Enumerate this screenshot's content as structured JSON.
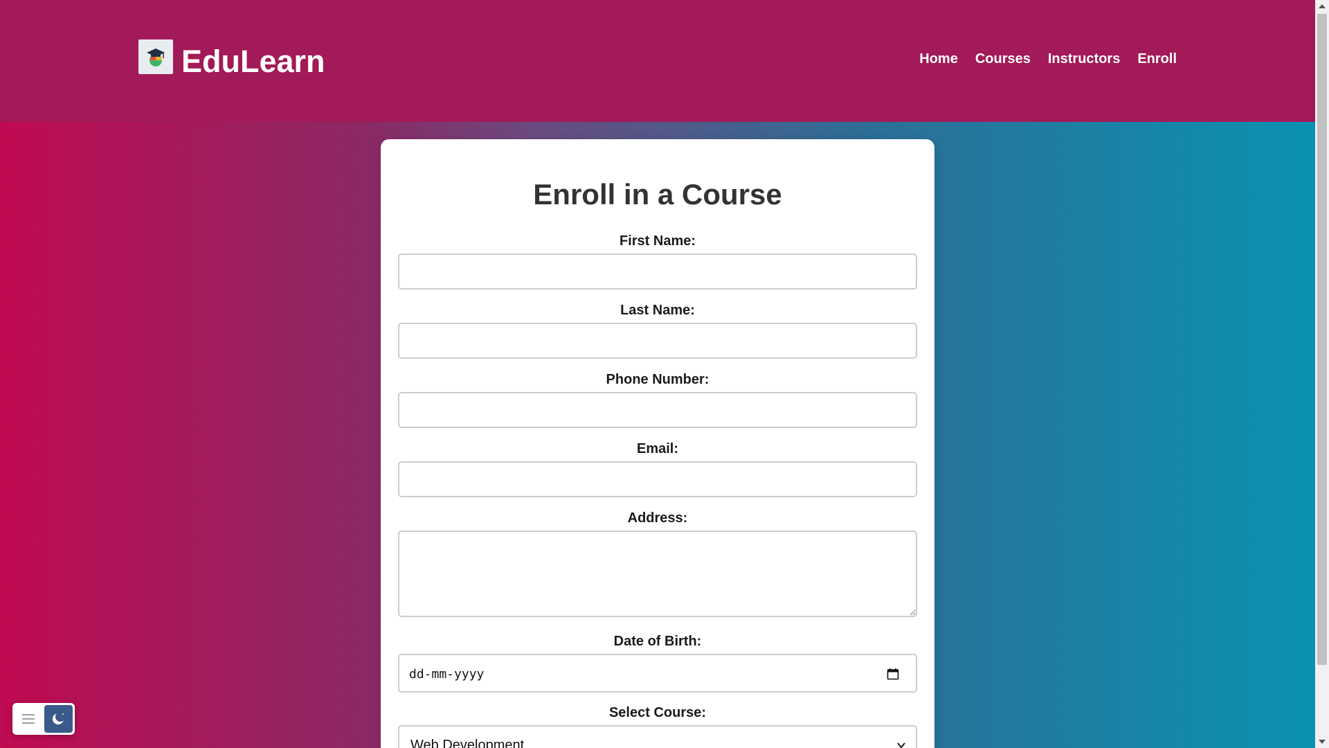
{
  "header": {
    "brand": "EduLearn",
    "nav": [
      "Home",
      "Courses",
      "Instructors",
      "Enroll"
    ]
  },
  "form": {
    "title": "Enroll in a Course",
    "fields": {
      "first_name": {
        "label": "First Name:",
        "value": ""
      },
      "last_name": {
        "label": "Last Name:",
        "value": ""
      },
      "phone": {
        "label": "Phone Number:",
        "value": ""
      },
      "email": {
        "label": "Email:",
        "value": ""
      },
      "address": {
        "label": "Address:",
        "value": ""
      },
      "dob": {
        "label": "Date of Birth:",
        "placeholder": "dd-mm-yyyy"
      },
      "course": {
        "label": "Select Course:",
        "selected": "Web Development"
      }
    }
  },
  "colors": {
    "header_bg": "#a21a58",
    "gradient_left": "#c00a52",
    "gradient_right": "#0a93b2",
    "card_bg": "#ffffff",
    "moon_button_bg": "#3a5a8a"
  },
  "icons": {
    "logo": "graduation-cap-logo-icon",
    "calendar": "calendar-icon",
    "select_chevron": "chevron-down-icon",
    "menu": "hamburger-menu-icon",
    "theme": "moon-icon"
  }
}
